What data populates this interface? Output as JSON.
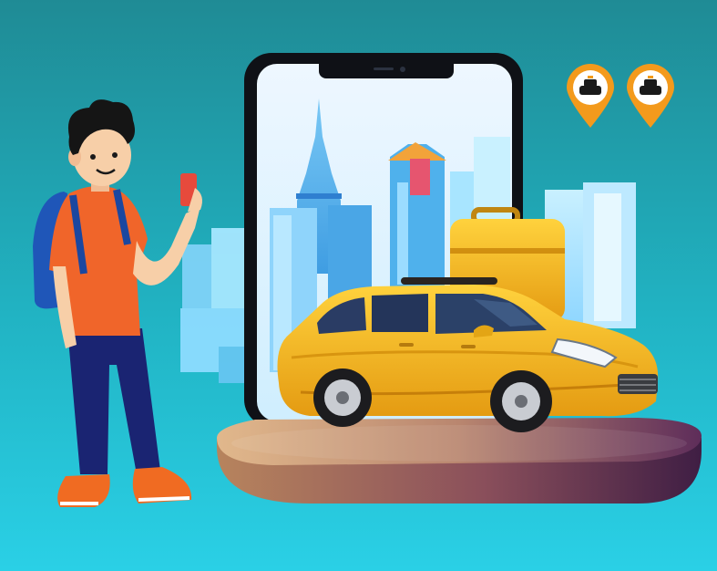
{
  "scene": {
    "description_visible_text": "",
    "colors": {
      "background_top": "#1f8b95",
      "background_bottom": "#2ad0e6",
      "phone_body": "#0f1116",
      "phone_screen_top": "#eef7ff",
      "phone_screen_bottom": "#cfeefe",
      "taxi_yellow": "#f2b81a",
      "taxi_shadow": "#d58d0b",
      "platform_left": "#d8a97a",
      "platform_right": "#5e2d5a",
      "pin_orange": "#f39a1c",
      "shirt": "#f0652a",
      "pants": "#1a2472",
      "backpack": "#1f56b8",
      "shoes": "#f06b22",
      "hair": "#151515",
      "skin": "#f7cfa8",
      "building_blue": "#5fb8f1",
      "building_light": "#a5e4ff",
      "suitcase": "#f2b81a"
    },
    "icons": [
      "taxi-location-pin-icon",
      "taxi-location-pin-icon"
    ]
  }
}
